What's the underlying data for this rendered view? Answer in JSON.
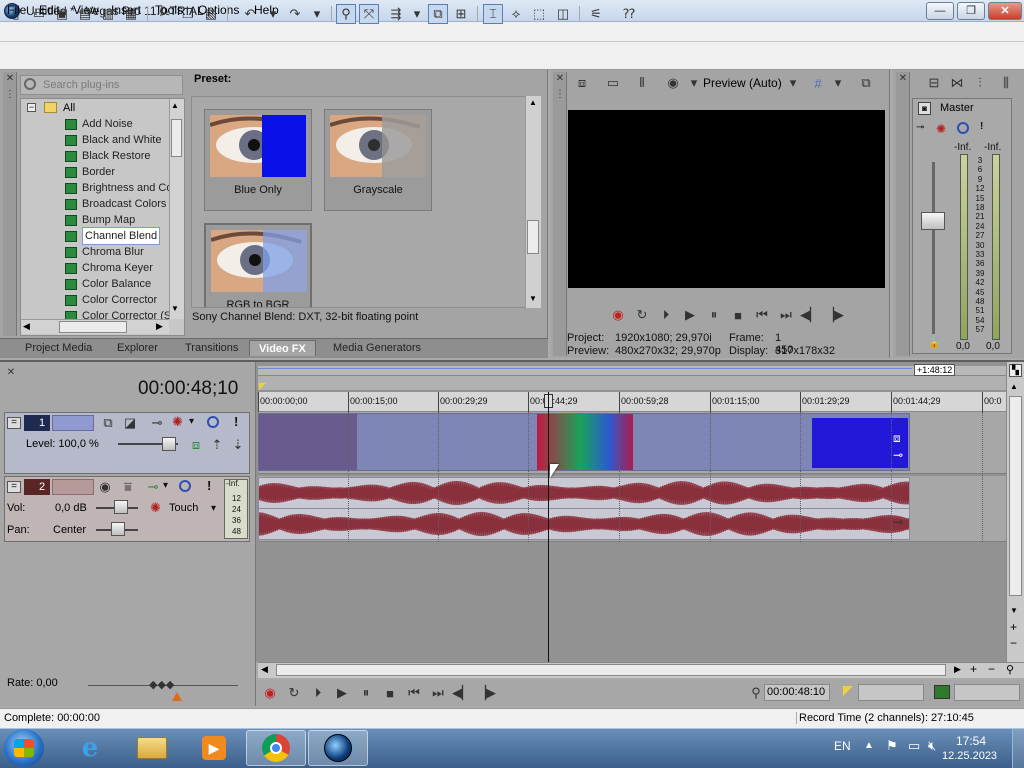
{
  "window": {
    "title": "Untitled * - Vegas Pro 11.0 TRIAL",
    "minimize": "—",
    "maximize": "❐",
    "close": "✕"
  },
  "menu": [
    "File",
    "Edit",
    "View",
    "Insert",
    "Tools",
    "Options",
    "Help"
  ],
  "search": {
    "placeholder": "Search plug-ins"
  },
  "tree": {
    "root": "All",
    "items": [
      "Add Noise",
      "Black and White",
      "Black Restore",
      "Border",
      "Brightness and Co",
      "Broadcast Colors",
      "Bump Map",
      "Channel Blend",
      "Chroma Blur",
      "Chroma Keyer",
      "Color Balance",
      "Color Corrector",
      "Color Corrector (S"
    ],
    "selected_index": 7
  },
  "presets": {
    "label": "Preset:",
    "items": [
      "Blue Only",
      "Grayscale",
      "RGB to BGR"
    ],
    "description": "Sony Channel Blend: DXT, 32-bit floating point"
  },
  "fx_tabs": [
    "Project Media",
    "Explorer",
    "Transitions",
    "Video FX",
    "Media Generators"
  ],
  "fx_tabs_active": 3,
  "preview": {
    "mode": "Preview (Auto)",
    "project_label": "Project:",
    "project_value": "1920x1080; 29,970i",
    "preview_label": "Preview:",
    "preview_value": "480x270x32; 29,970p",
    "frame_label": "Frame:",
    "frame_value": "1 450",
    "display_label": "Display:",
    "display_value": "317x178x32"
  },
  "master": {
    "title": "Master",
    "inf_left": "-Inf.",
    "inf_right": "-Inf.",
    "scale": [
      "3",
      "6",
      "9",
      "12",
      "15",
      "18",
      "21",
      "24",
      "27",
      "30",
      "33",
      "36",
      "39",
      "42",
      "45",
      "48",
      "51",
      "54",
      "57"
    ],
    "out_left": "0,0",
    "out_right": "0,0"
  },
  "timeline": {
    "time": "00:00:48;10",
    "end_marker": "+1:48:12",
    "ruler": [
      "00:00:00;00",
      "00:00:15;00",
      "00:00:29;29",
      "00:00:44;29",
      "00:00:59;28",
      "00:01:15;00",
      "00:01:29;29",
      "00:01:44;29",
      "00:0"
    ]
  },
  "video_track": {
    "number": "1",
    "level": "Level: 100,0 %"
  },
  "audio_track": {
    "number": "2",
    "vol_label": "Vol:",
    "vol_value": "0,0 dB",
    "pan_label": "Pan:",
    "pan_value": "Center",
    "mode": "Touch",
    "meter_top": "-Inf.",
    "meter_scale": [
      "12",
      "24",
      "36",
      "48"
    ]
  },
  "rate": {
    "label": "Rate: 0,00"
  },
  "transport": {
    "time": "00:00:48:10"
  },
  "status": {
    "left": "Complete: 00:00:00",
    "right": "Record Time (2 channels): 27:10:45"
  },
  "tray": {
    "lang": "EN",
    "time": "17:54",
    "date": "12.25.2023"
  },
  "colors": {
    "accent": "#5b7fb0",
    "video_event": "#7e86b6",
    "audio_wave": "#8a2f3c"
  }
}
